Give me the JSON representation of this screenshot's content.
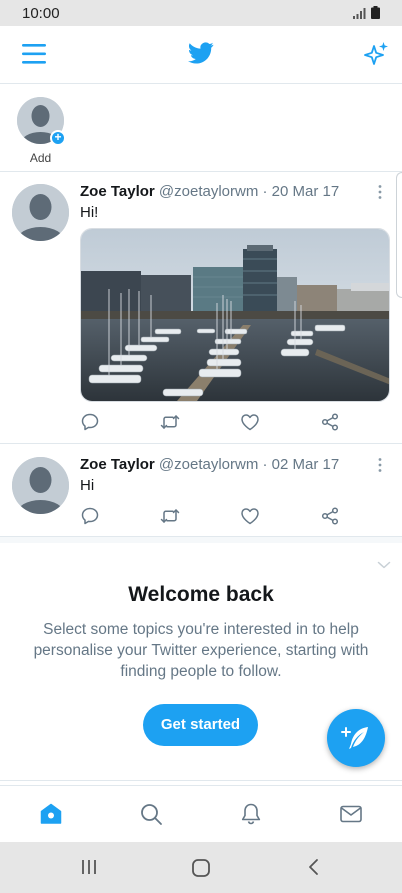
{
  "status_bar": {
    "time": "10:00"
  },
  "header": {
    "logo_icon": "twitter-bird-icon",
    "menu_icon": "menu-icon",
    "sparkle_icon": "sparkle-icon"
  },
  "fleets": {
    "add_label": "Add"
  },
  "tweets": [
    {
      "name": "Zoe Taylor",
      "meta": "@zoetaylorwm · 20 Mar 17",
      "text": "Hi!",
      "has_image": true
    },
    {
      "name": "Zoe Taylor",
      "meta": "@zoetaylorwm · 02 Mar 17",
      "text": "Hi",
      "has_image": false
    }
  ],
  "welcome": {
    "title": "Welcome back",
    "body": "Select some topics you're interested in to help personalise your Twitter experience, starting with finding people to follow.",
    "button": "Get started"
  },
  "colors": {
    "brand": "#1da1f2",
    "text": "#14171a",
    "muted": "#657786"
  }
}
